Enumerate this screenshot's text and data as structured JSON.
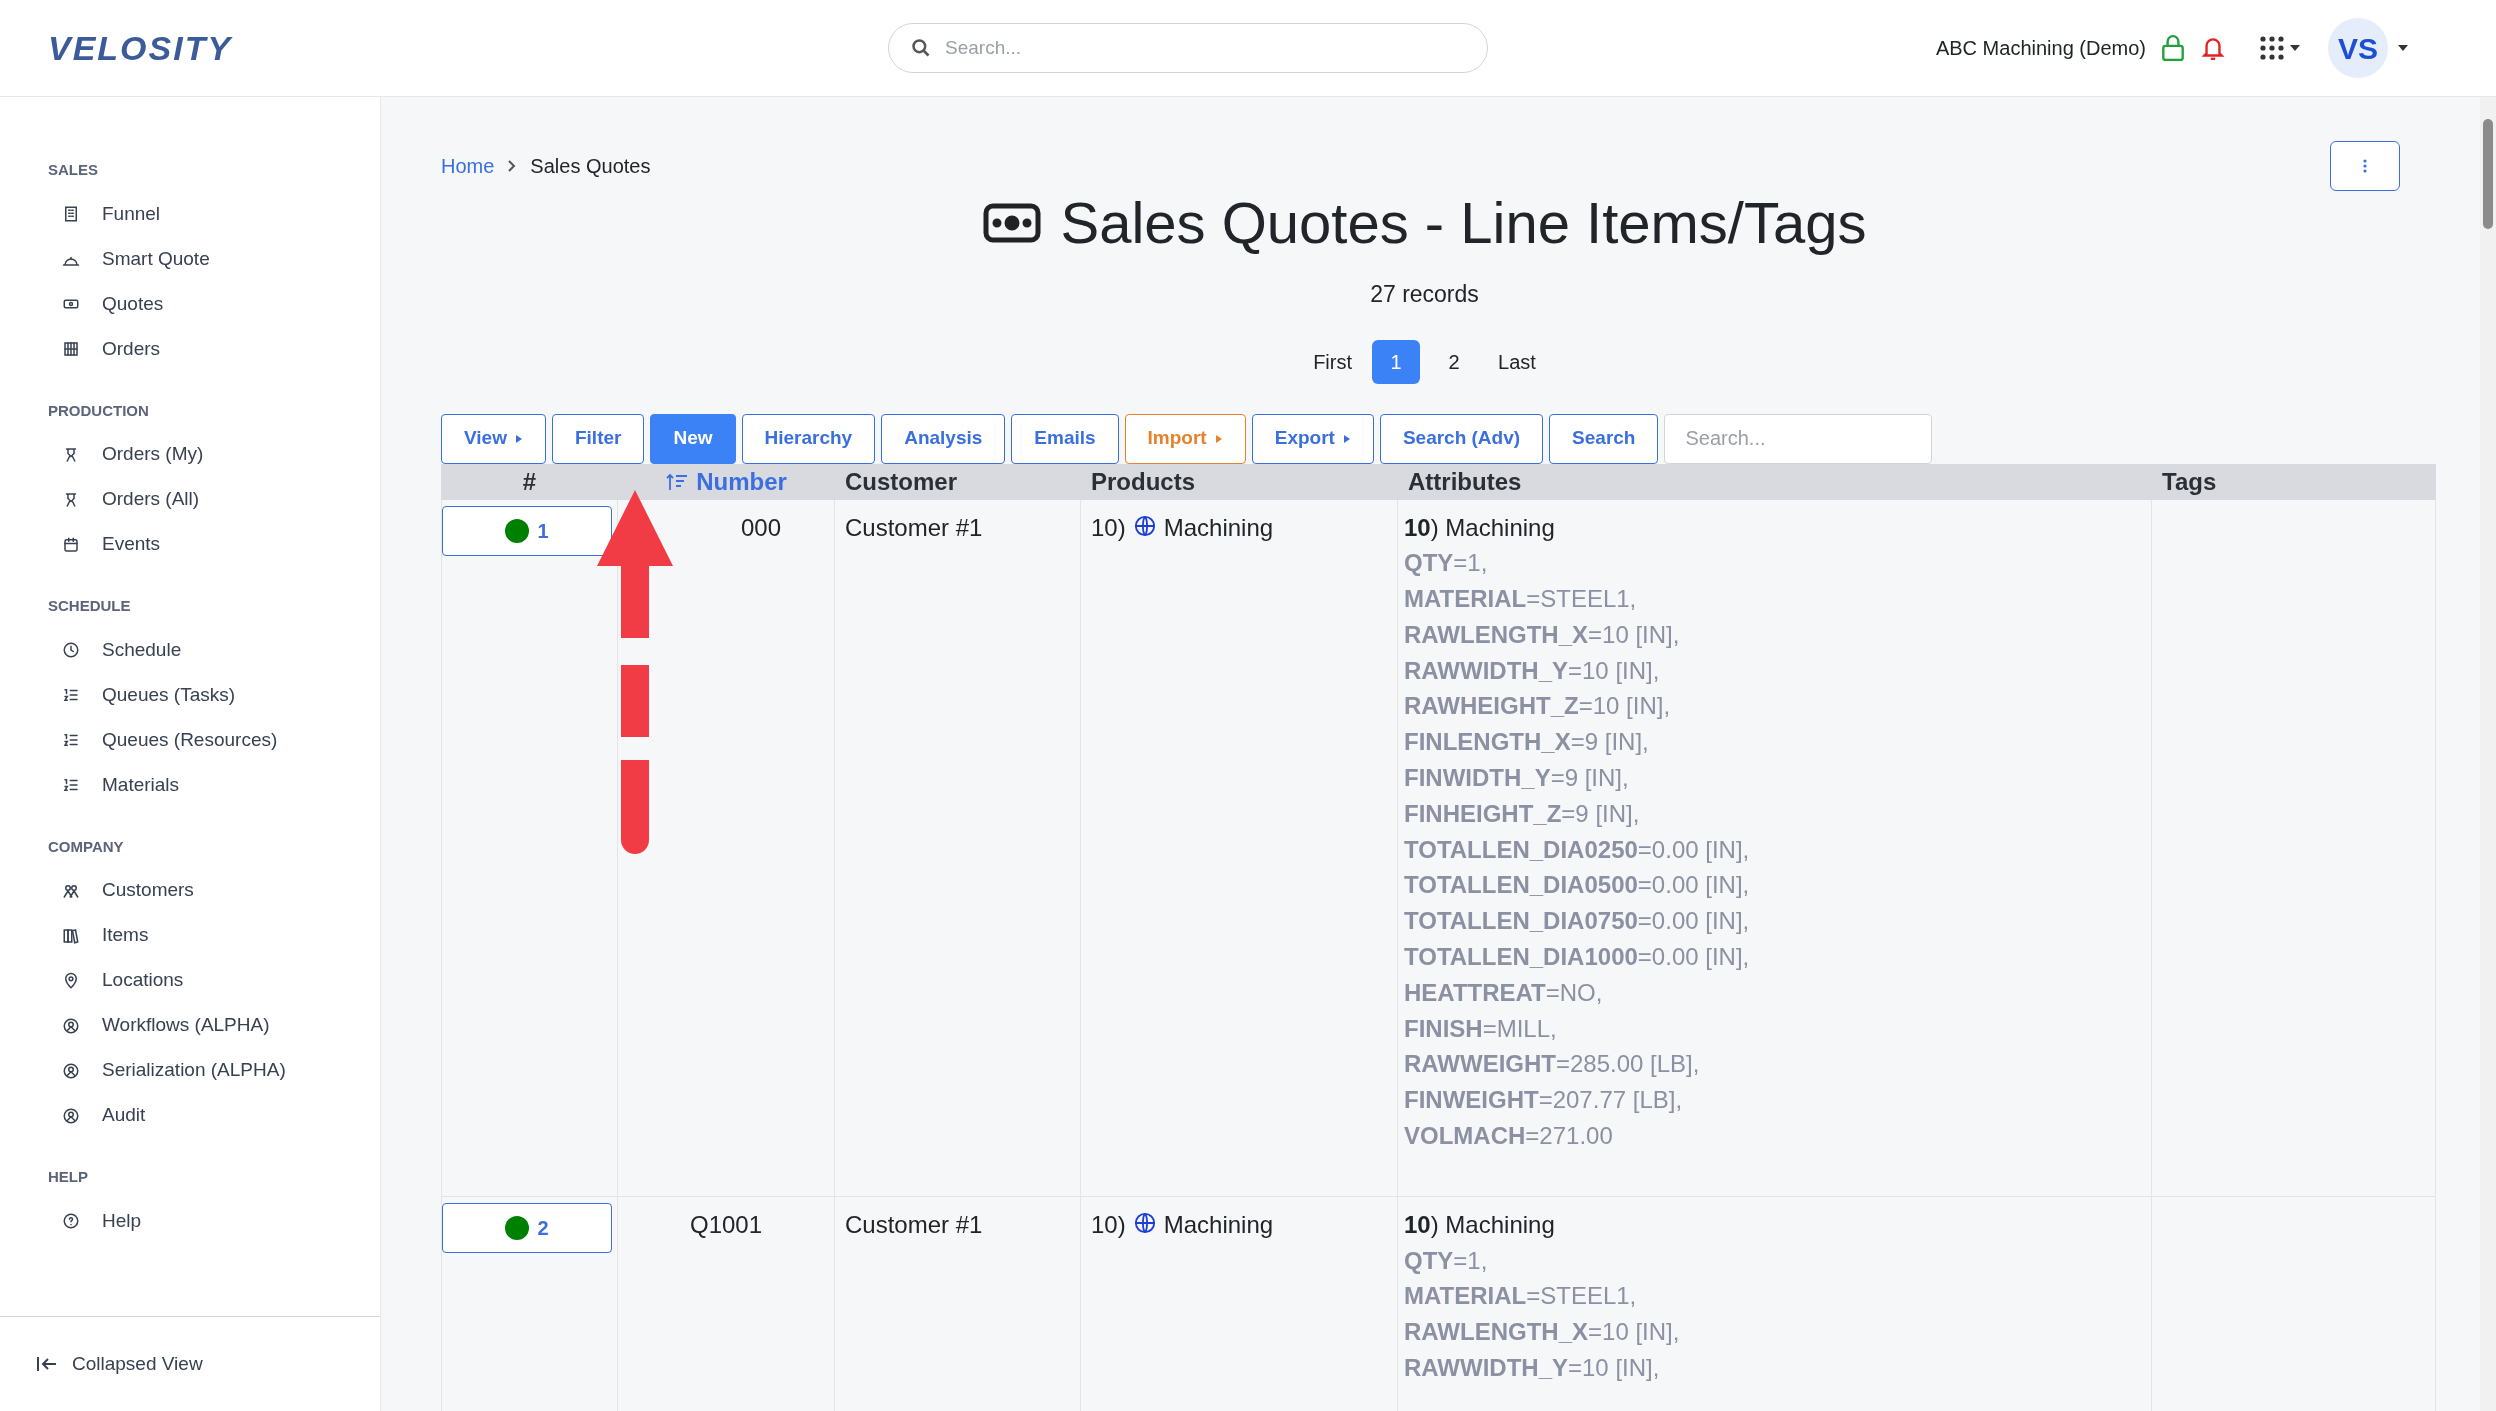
{
  "header": {
    "logo": "VELOSITY",
    "search": {
      "placeholder": "Search..."
    },
    "company": "ABC Machining (Demo)",
    "avatar": "VS"
  },
  "sidebar": {
    "sections": [
      {
        "title": "SALES",
        "items": [
          {
            "label": "Funnel"
          },
          {
            "label": "Smart Quote"
          },
          {
            "label": "Quotes"
          },
          {
            "label": "Orders"
          }
        ]
      },
      {
        "title": "PRODUCTION",
        "items": [
          {
            "label": "Orders (My)"
          },
          {
            "label": "Orders (All)"
          },
          {
            "label": "Events"
          }
        ]
      },
      {
        "title": "SCHEDULE",
        "items": [
          {
            "label": "Schedule"
          },
          {
            "label": "Queues (Tasks)"
          },
          {
            "label": "Queues (Resources)"
          },
          {
            "label": "Materials"
          }
        ]
      },
      {
        "title": "COMPANY",
        "items": [
          {
            "label": "Customers"
          },
          {
            "label": "Items"
          },
          {
            "label": "Locations"
          },
          {
            "label": "Workflows (ALPHA)"
          },
          {
            "label": "Serialization (ALPHA)"
          },
          {
            "label": "Audit"
          }
        ]
      },
      {
        "title": "HELP",
        "items": [
          {
            "label": "Help"
          }
        ]
      }
    ],
    "footer": "Collapsed View"
  },
  "breadcrumb": [
    "Home",
    "Sales Quotes"
  ],
  "title": "Sales Quotes - Line Items/Tags",
  "record_count": "27 records",
  "pagination": [
    {
      "label": "First",
      "selected": false
    },
    {
      "label": "1",
      "selected": true
    },
    {
      "label": "2",
      "selected": false
    },
    {
      "label": "Last",
      "selected": false
    }
  ],
  "toolbar": [
    {
      "label": "View",
      "kind": "menu"
    },
    {
      "label": "Filter",
      "kind": "plain"
    },
    {
      "label": "New",
      "kind": "primary"
    },
    {
      "label": "Hierarchy",
      "kind": "plain"
    },
    {
      "label": "Analysis",
      "kind": "plain"
    },
    {
      "label": "Emails",
      "kind": "plain"
    },
    {
      "label": "Import",
      "kind": "warnmenu"
    },
    {
      "label": "Export",
      "kind": "menu"
    },
    {
      "label": "Search (Adv)",
      "kind": "plain"
    },
    {
      "label": "Search",
      "kind": "plain"
    }
  ],
  "table_search": {
    "placeholder": "Search..."
  },
  "table": {
    "columns": [
      {
        "label": "#",
        "sorted": false
      },
      {
        "label": "Number",
        "sorted": true
      },
      {
        "label": "Customer",
        "sorted": false
      },
      {
        "label": "Products",
        "sorted": false
      },
      {
        "label": "Attributes",
        "sorted": false
      },
      {
        "label": "Tags",
        "sorted": false
      }
    ],
    "rows": [
      {
        "index": "1",
        "color": "#008000",
        "number": "000",
        "customer": "Customer #1",
        "product_no": "10)",
        "product": "Machining",
        "attributes": [
          "**10**) Machining",
          "**QTY**=1,",
          "**MATERIAL**=STEEL1,",
          "**RAWLENGTH_X**=10 [IN],",
          "**RAWWIDTH_Y**=10 [IN],",
          "**RAWHEIGHT_Z**=10 [IN],",
          "**FINLENGTH_X**=9 [IN],",
          "**FINWIDTH_Y**=9 [IN],",
          "**FINHEIGHT_Z**=9 [IN],",
          "**TOTALLEN_DIA0250**=0.00 [IN],",
          "**TOTALLEN_DIA0500**=0.00 [IN],",
          "**TOTALLEN_DIA0750**=0.00 [IN],",
          "**TOTALLEN_DIA1000**=0.00 [IN],",
          "**HEATTREAT**=NO,",
          "**FINISH**=MILL,",
          "**RAWWEIGHT**=285.00 [LB],",
          "**FINWEIGHT**=207.77 [LB],",
          "**VOLMACH**=271.00"
        ]
      },
      {
        "index": "2",
        "color": "#008000",
        "number": "Q1001",
        "customer": "Customer #1",
        "product_no": "10)",
        "product": "Machining",
        "attributes": [
          "**10**) Machining",
          "**QTY**=1,",
          "**MATERIAL**=STEEL1,",
          "**RAWLENGTH_X**=10 [IN],",
          "**RAWWIDTH_Y**=10 [IN],"
        ]
      }
    ]
  }
}
